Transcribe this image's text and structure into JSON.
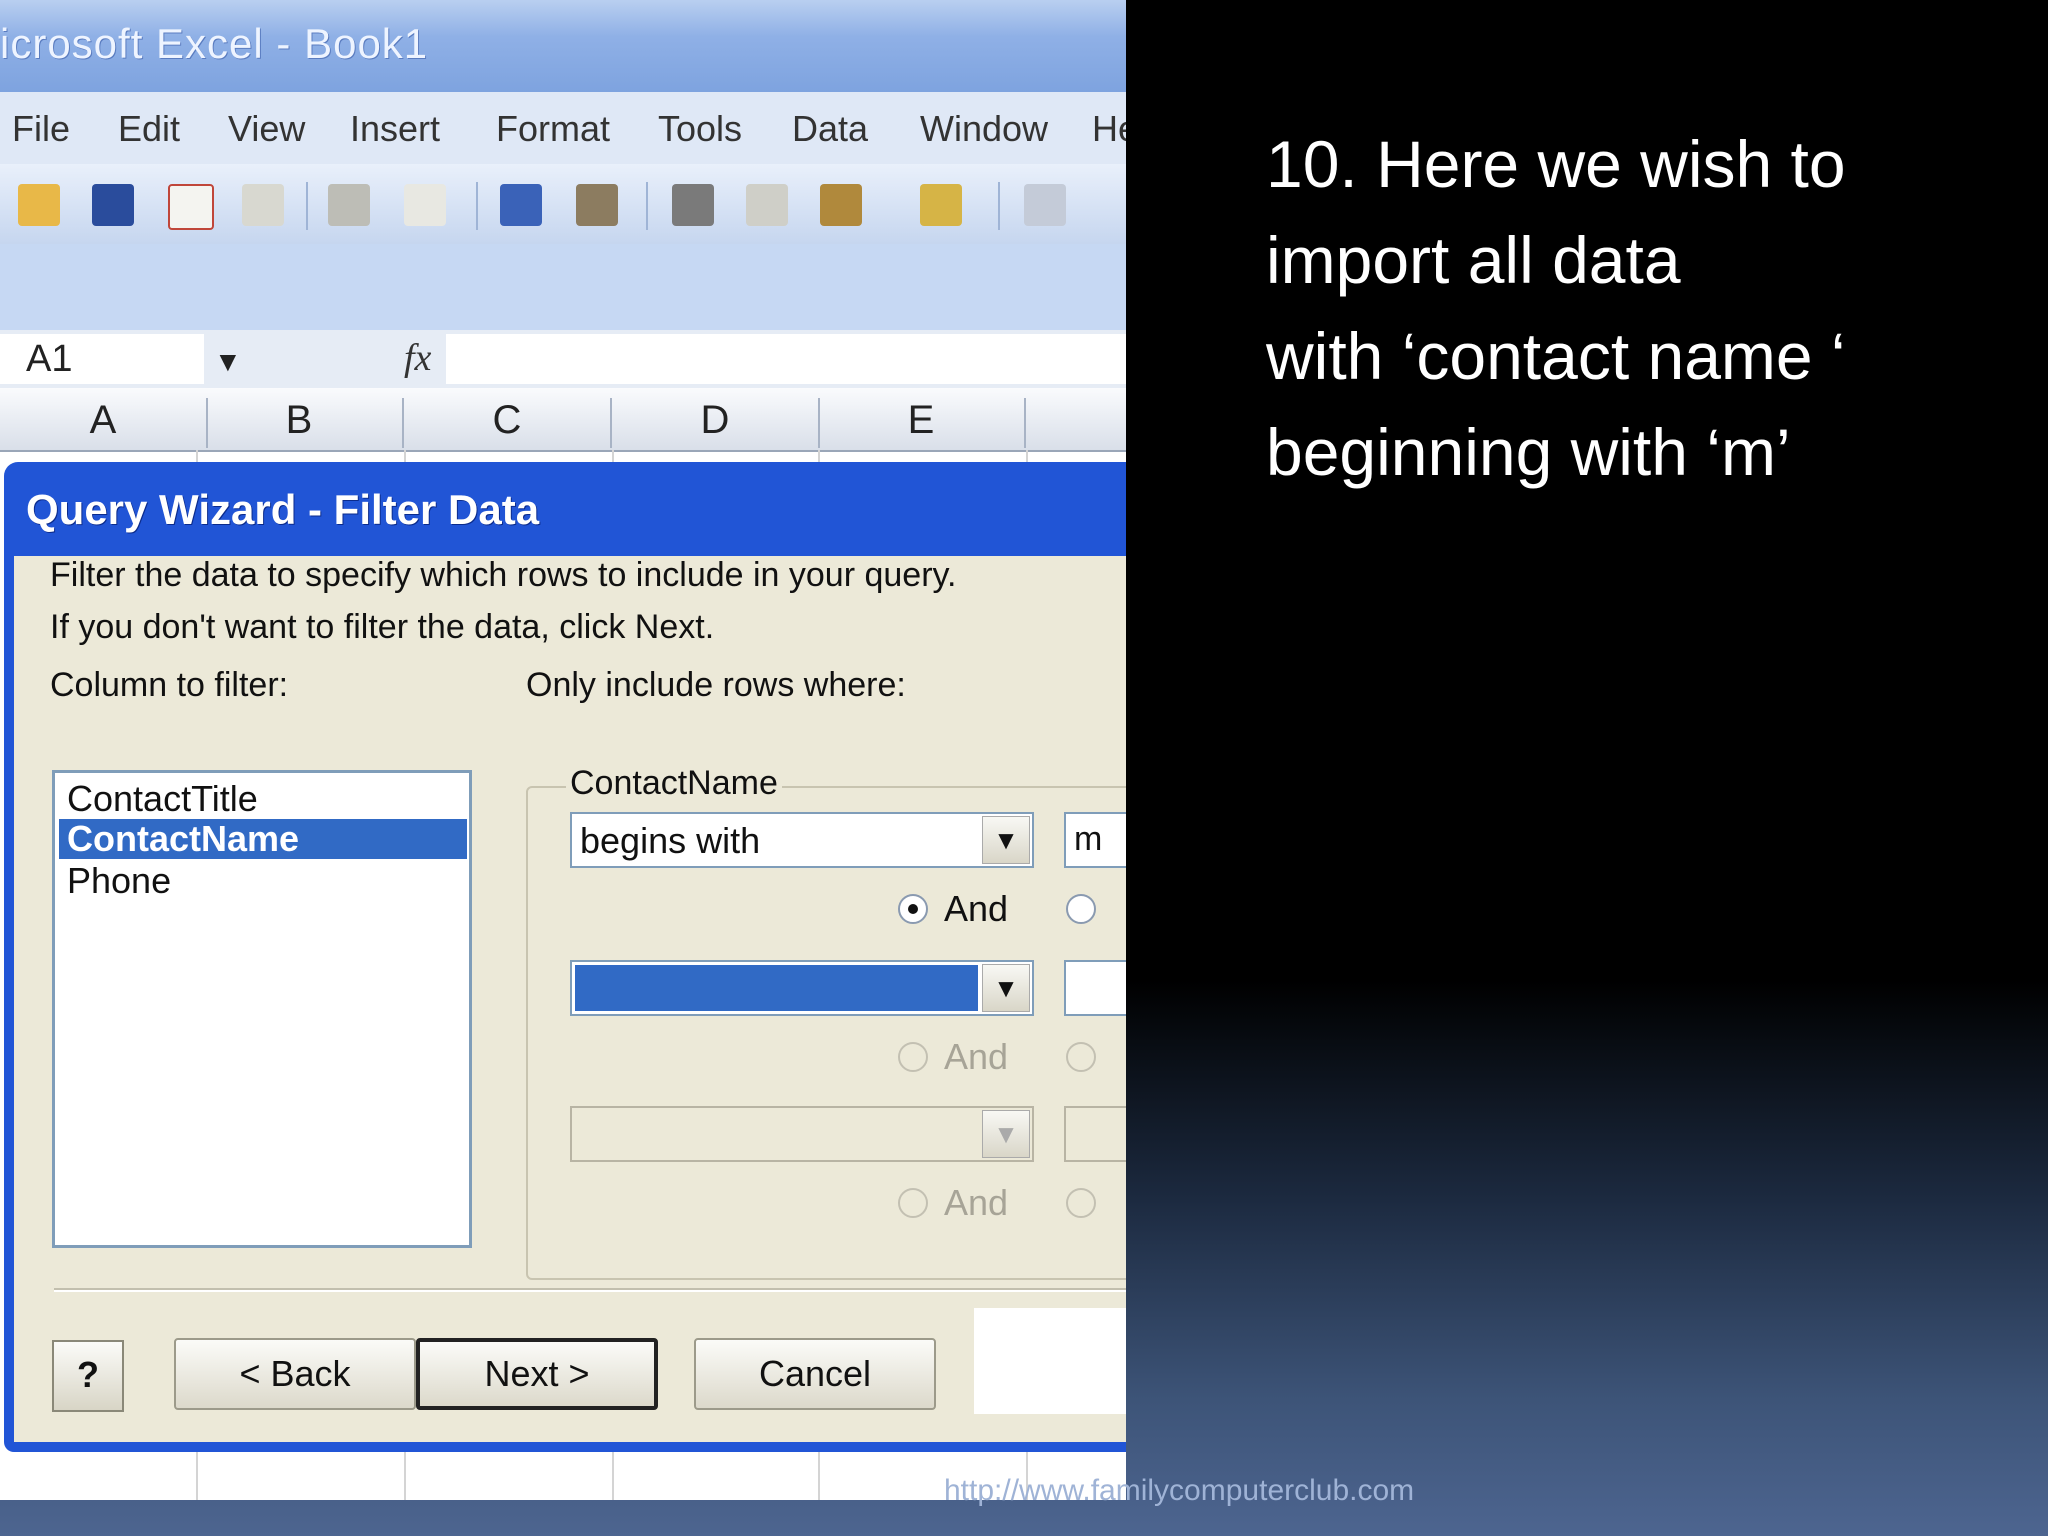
{
  "window": {
    "title": "icrosoft Excel - Book1"
  },
  "menu": {
    "items": [
      "File",
      "Edit",
      "View",
      "Insert",
      "Format",
      "Tools",
      "Data",
      "Window",
      "He"
    ]
  },
  "toolbar": {
    "icons": [
      "open-icon",
      "save-icon",
      "permission-icon",
      "email-icon",
      "print-icon",
      "print-preview-icon",
      "spelling-icon",
      "research-icon",
      "cut-icon",
      "copy-icon",
      "paste-icon",
      "format-painter-icon",
      "undo-icon"
    ]
  },
  "formula_bar": {
    "name_box": "A1",
    "fx": "fx"
  },
  "columns": [
    "A",
    "B",
    "C",
    "D",
    "E"
  ],
  "dialog": {
    "title": "Query Wizard - Filter Data",
    "instructions_1": "Filter the data to specify which rows to include in your query.",
    "instructions_2": "If you don't want to filter the data, click Next.",
    "column_label": "Column to filter:",
    "rows_label": "Only include rows where:",
    "columns": [
      "ContactTitle",
      "ContactName",
      "Phone"
    ],
    "selected_column": "ContactName",
    "group_label": "ContactName",
    "condition_1": {
      "operator": "begins with",
      "value": "m"
    },
    "and_label": "And",
    "buttons": {
      "help": "?",
      "back": "< Back",
      "next": "Next >",
      "cancel": "Cancel"
    }
  },
  "slide": {
    "lines": [
      "10. Here we wish to",
      "import all data",
      "with ‘contact name ‘",
      "beginning with ‘m’"
    ],
    "footer": "http://www.familycomputerclub.com"
  }
}
